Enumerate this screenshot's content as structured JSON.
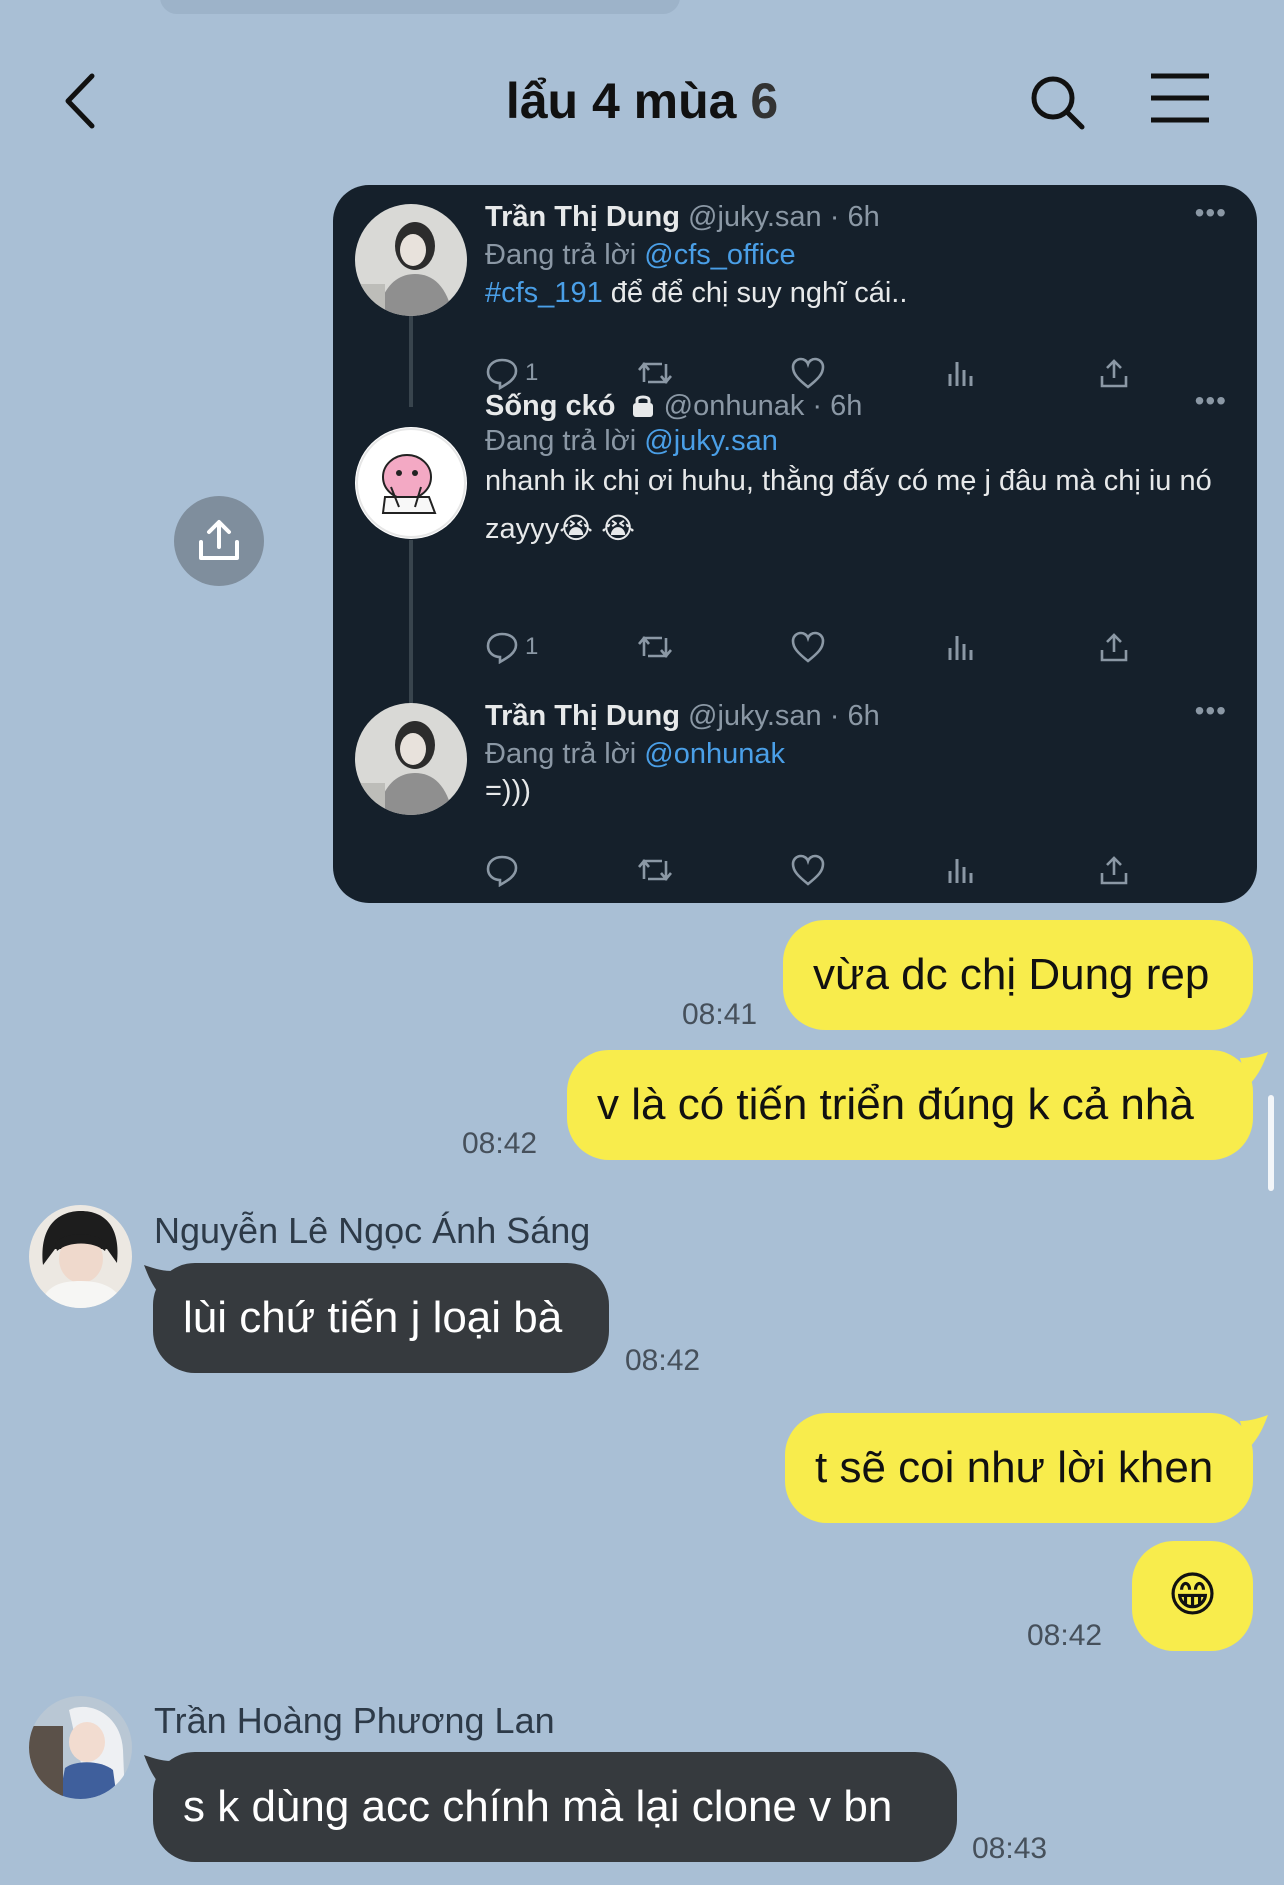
{
  "header": {
    "title": "lẩu 4 mùa",
    "member_count": "6",
    "back_icon": "chevron-left-icon",
    "search_icon": "search-icon",
    "menu_icon": "hamburger-menu-icon"
  },
  "colors": {
    "chat_background": "#a9bfd5",
    "my_bubble": "#f8ec4c",
    "their_bubble": "#363a3e",
    "tweet_background": "#15202b",
    "tweet_link": "#4a9fe7"
  },
  "tweet_screenshot": {
    "tweets": [
      {
        "name": "Trần Thị Dung",
        "handle": "@juky.san",
        "time": "6h",
        "replying_label": "Đang trả lời",
        "replying_to": "@cfs_office",
        "hashtag": "#cfs_191",
        "text": "để để chị suy nghĩ cái..",
        "reply_count": "1"
      },
      {
        "name": "Sống ckó",
        "handle": "@onhunak",
        "time": "6h",
        "replying_label": "Đang trả lời",
        "replying_to": "@juky.san",
        "text": "nhanh ik chị ơi huhu, thằng đấy có mẹ j đâu mà chị iu nó zayyy😭 😭",
        "reply_count": "1"
      },
      {
        "name": "Trần Thị Dung",
        "handle": "@juky.san",
        "time": "6h",
        "replying_label": "Đang trả lời",
        "replying_to": "@onhunak",
        "text": "=)))",
        "reply_count": ""
      }
    ]
  },
  "messages": [
    {
      "from": "me",
      "text": "vừa dc chị Dung rep",
      "time": "08:41"
    },
    {
      "from": "me",
      "text": "v là có tiến triển đúng k cả nhà",
      "time": "08:42"
    },
    {
      "from": "them",
      "sender": "Nguyễn Lê Ngọc Ánh Sáng",
      "text": "lùi chứ tiến j loại bà",
      "time": "08:42"
    },
    {
      "from": "me",
      "text": "t sẽ coi như lời khen",
      "time": ""
    },
    {
      "from": "me",
      "text": "😁",
      "time": "08:42"
    },
    {
      "from": "them",
      "sender": "Trần Hoàng Phương Lan",
      "text": "s k dùng acc chính mà lại clone v bn",
      "time": "08:43"
    }
  ]
}
